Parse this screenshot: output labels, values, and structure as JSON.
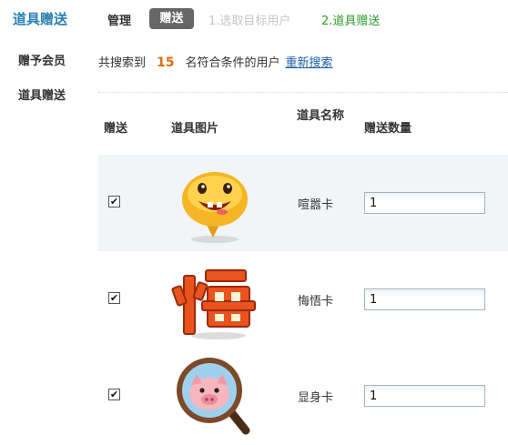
{
  "header": {
    "title": "道具赠送",
    "tabs": [
      {
        "label": "管理",
        "active": false
      },
      {
        "label": "赠送",
        "active": true
      }
    ],
    "steps": [
      {
        "label": "1.选取目标用户",
        "state": "done"
      },
      {
        "label": "2.道具赠送",
        "state": "current"
      }
    ]
  },
  "sidebar": {
    "items": [
      {
        "label": "赠予会员"
      },
      {
        "label": "道具赠送"
      }
    ]
  },
  "summary": {
    "prefix": "共搜索到",
    "count": "15",
    "suffix": "名符合条件的用户",
    "research_link": "重新搜索"
  },
  "table": {
    "headers": {
      "gift": "赠送",
      "image": "道具图片",
      "name": "道具名称",
      "quantity": "赠送数量"
    },
    "rows": [
      {
        "checked": true,
        "icon": "smiley-speech-bubble-icon",
        "name": "喧嚣卡",
        "quantity": "1"
      },
      {
        "checked": true,
        "icon": "hui-character-icon",
        "name": "悔悟卡",
        "quantity": "1"
      },
      {
        "checked": true,
        "icon": "magnifier-pig-icon",
        "name": "显身卡",
        "quantity": "1"
      }
    ]
  },
  "colors": {
    "title": "#2a7fb5",
    "active_tab_bg": "#666666",
    "step_done": "#c6c6c6",
    "step_current": "#2f9c2f",
    "count": "#e26d12",
    "link": "#1c5ea8",
    "row_highlight": "#f1f5f8"
  }
}
